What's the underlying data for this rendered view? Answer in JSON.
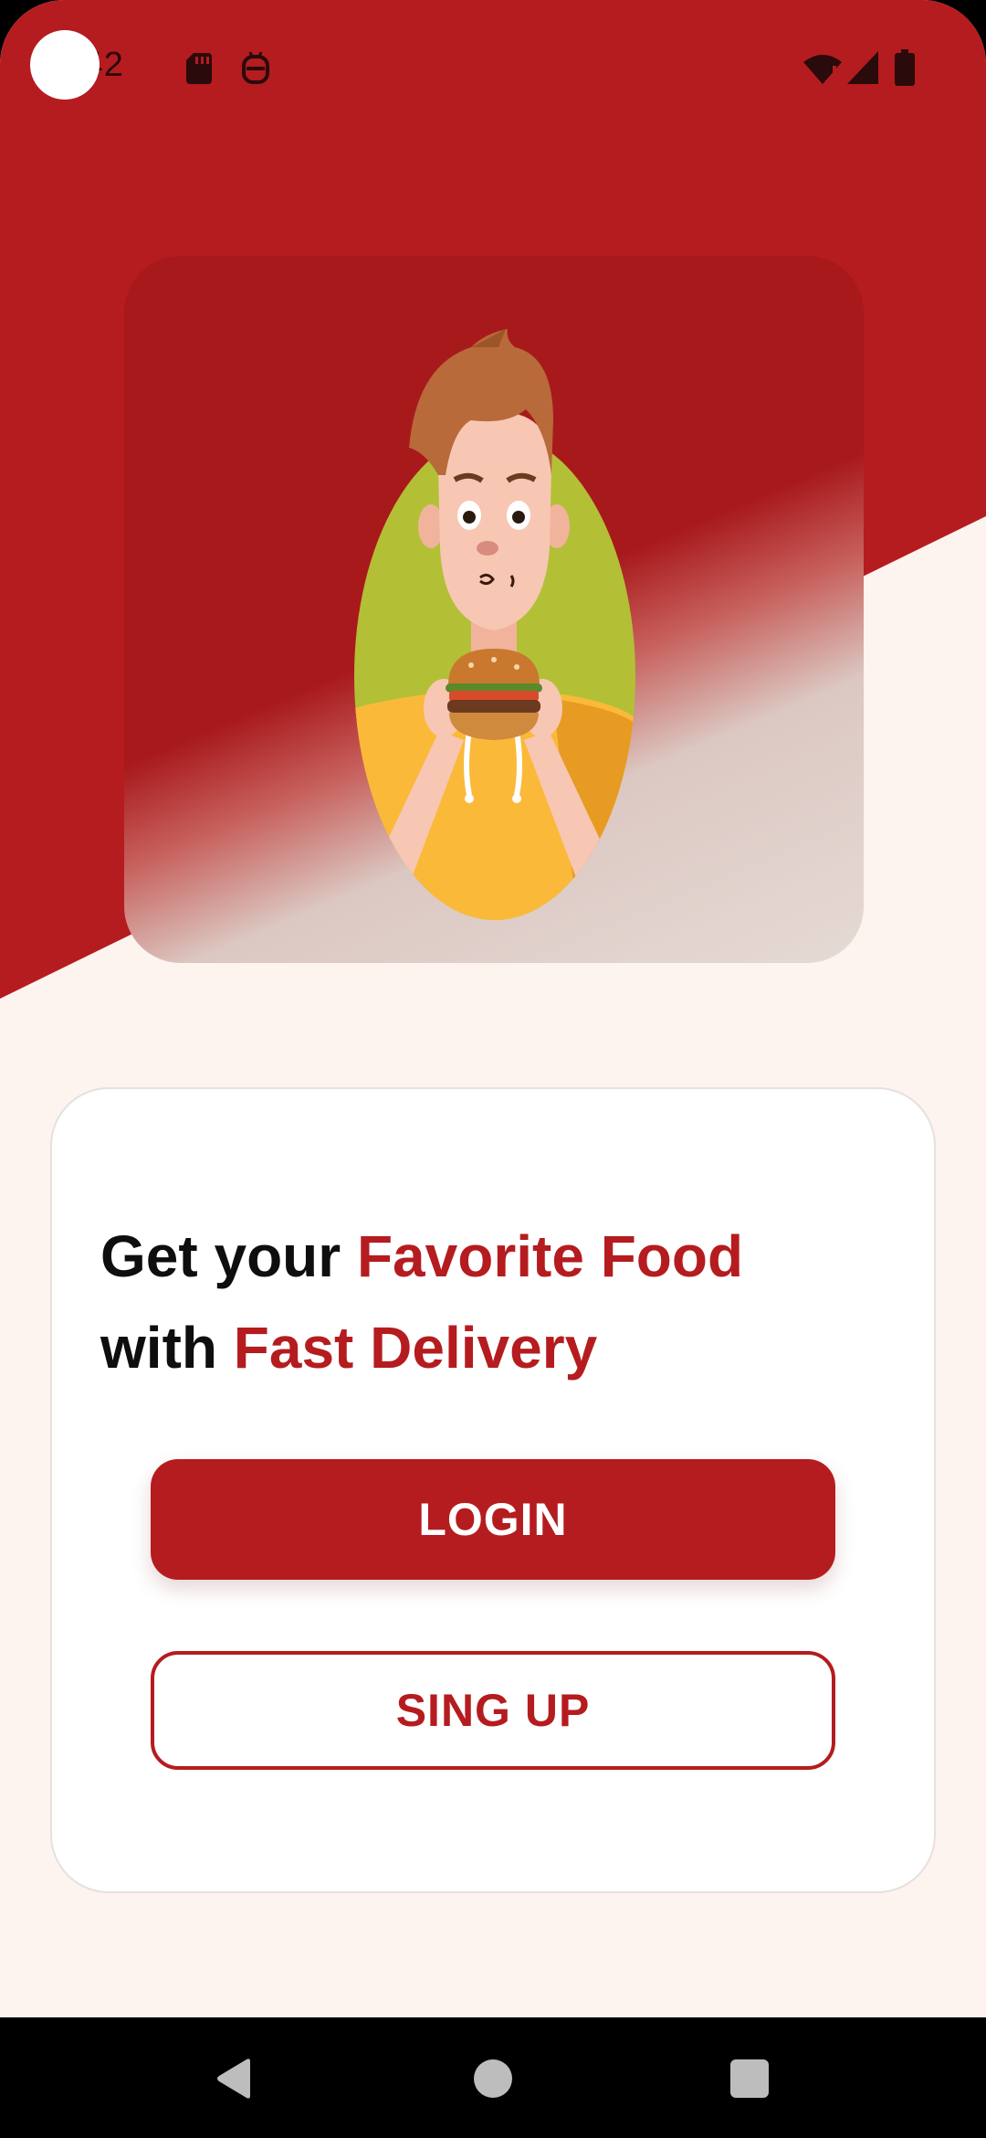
{
  "status_bar": {
    "time": ":42",
    "icons": [
      "sd-card-icon",
      "robot-icon",
      "wifi-icon",
      "signal-icon",
      "battery-icon"
    ]
  },
  "hero": {
    "illustration": "man-eating-burger"
  },
  "headline": {
    "part1": "Get your ",
    "part2": "Favorite Food",
    "part3": "with ",
    "part4": "Fast Delivery"
  },
  "buttons": {
    "login": "LOGIN",
    "signup": "SING UP"
  },
  "nav": {
    "icons": [
      "back-icon",
      "home-icon",
      "recents-icon"
    ]
  },
  "colors": {
    "primary": "#b51c1f",
    "background": "#fdf3ef",
    "card": "#ffffff"
  }
}
